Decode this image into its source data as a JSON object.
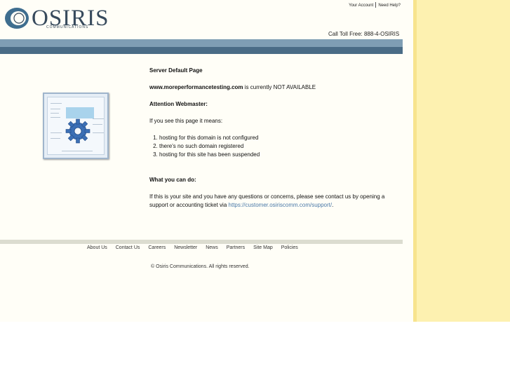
{
  "header": {
    "logo_text": "OSIRIS",
    "logo_sub": "COMMUNICATIONS",
    "top_links": [
      "Your Account",
      "Need Help?"
    ],
    "toll_free": "Call Toll Free: 888-4-OSIRIS"
  },
  "main": {
    "title": "Server Default Page",
    "domain": "www.moreperformancetesting.com",
    "domain_status": " is currently NOT AVAILABLE",
    "attention": "Attention Webmaster:",
    "intro": "If you see this page it means:",
    "reasons": [
      "hosting for this domain is not configured",
      "there's no such domain registered",
      "hosting for this site has been suspended"
    ],
    "what_title": "What you can do:",
    "what_text": "If this is your site and you have any questions or concerns, please see contact us by opening a support or accounting ticket via ",
    "support_link": "https://customer.osiriscomm.com/support/",
    "support_after": "."
  },
  "footer": {
    "nav": [
      "About Us",
      "Contact Us",
      "Careers",
      "Newsletter",
      "News",
      "Partners",
      "Site Map",
      "Policies"
    ],
    "copyright": "© Osiris Communications. All rights reserved."
  },
  "colors": {
    "band_light": "#7f9eb4",
    "band_dark": "#4a6c86",
    "right_strip": "#fdf1b0",
    "link": "#4a79a8"
  },
  "icons": [
    "osiris-logo-icon",
    "gear-icon"
  ]
}
